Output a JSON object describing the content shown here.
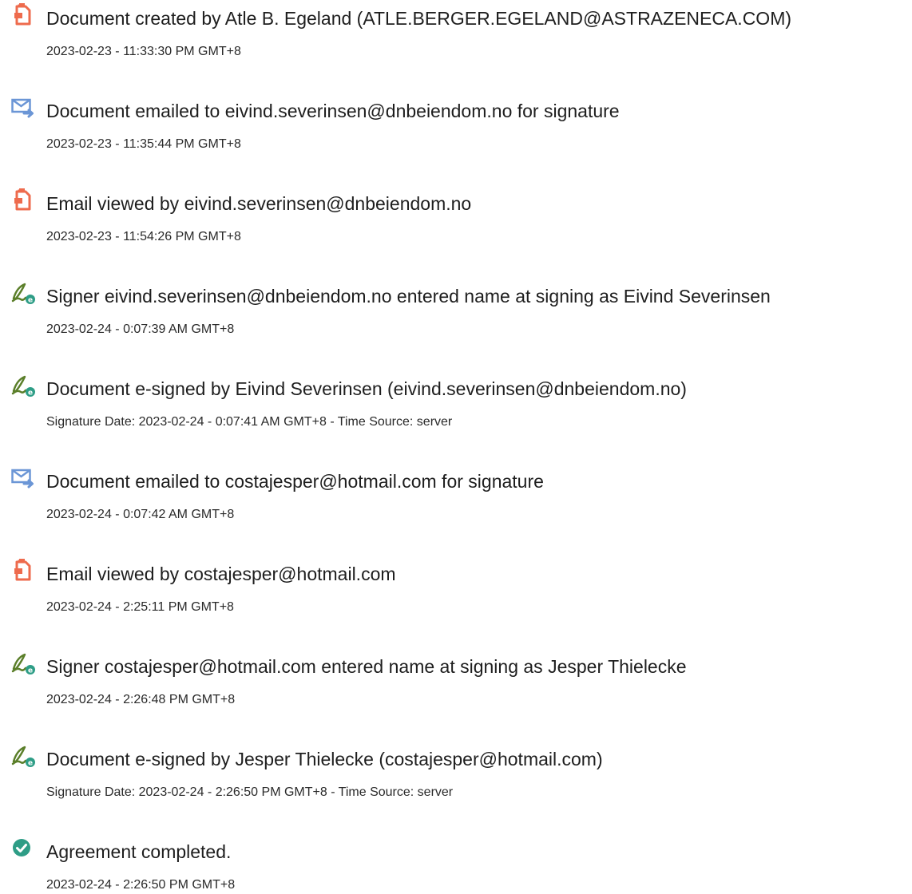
{
  "colors": {
    "doc_icon": "#ee6b4d",
    "email_icon": "#6b96d6",
    "sign_icon": "#5b7f2a",
    "sign_badge": "#2e9d86",
    "complete_icon": "#2e9d86"
  },
  "events": [
    {
      "icon": "document-icon",
      "title": "Document created by Atle B. Egeland (ATLE.BERGER.EGELAND@ASTRAZENECA.COM)",
      "meta": "2023-02-23 - 11:33:30 PM GMT+8"
    },
    {
      "icon": "email-sent-icon",
      "title": "Document emailed to eivind.severinsen@dnbeiendom.no for signature",
      "meta": "2023-02-23 - 11:35:44 PM GMT+8"
    },
    {
      "icon": "document-icon",
      "title": "Email viewed by eivind.severinsen@dnbeiendom.no",
      "meta": "2023-02-23 - 11:54:26 PM GMT+8"
    },
    {
      "icon": "signature-pen-icon",
      "title": "Signer eivind.severinsen@dnbeiendom.no entered name at signing as Eivind Severinsen",
      "meta": "2023-02-24 - 0:07:39 AM GMT+8"
    },
    {
      "icon": "signature-pen-icon",
      "title": "Document e-signed by Eivind Severinsen (eivind.severinsen@dnbeiendom.no)",
      "meta": "Signature Date: 2023-02-24 - 0:07:41 AM GMT+8 - Time Source: server"
    },
    {
      "icon": "email-sent-icon",
      "title": "Document emailed to costajesper@hotmail.com for signature",
      "meta": "2023-02-24 - 0:07:42 AM GMT+8"
    },
    {
      "icon": "document-icon",
      "title": "Email viewed by costajesper@hotmail.com",
      "meta": "2023-02-24 - 2:25:11 PM GMT+8"
    },
    {
      "icon": "signature-pen-icon",
      "title": "Signer costajesper@hotmail.com entered name at signing as Jesper Thielecke",
      "meta": "2023-02-24 - 2:26:48 PM GMT+8"
    },
    {
      "icon": "signature-pen-icon",
      "title": "Document e-signed by Jesper Thielecke (costajesper@hotmail.com)",
      "meta": "Signature Date: 2023-02-24 - 2:26:50 PM GMT+8 - Time Source: server"
    },
    {
      "icon": "check-circle-icon",
      "title": "Agreement completed.",
      "meta": "2023-02-24 - 2:26:50 PM GMT+8"
    }
  ]
}
